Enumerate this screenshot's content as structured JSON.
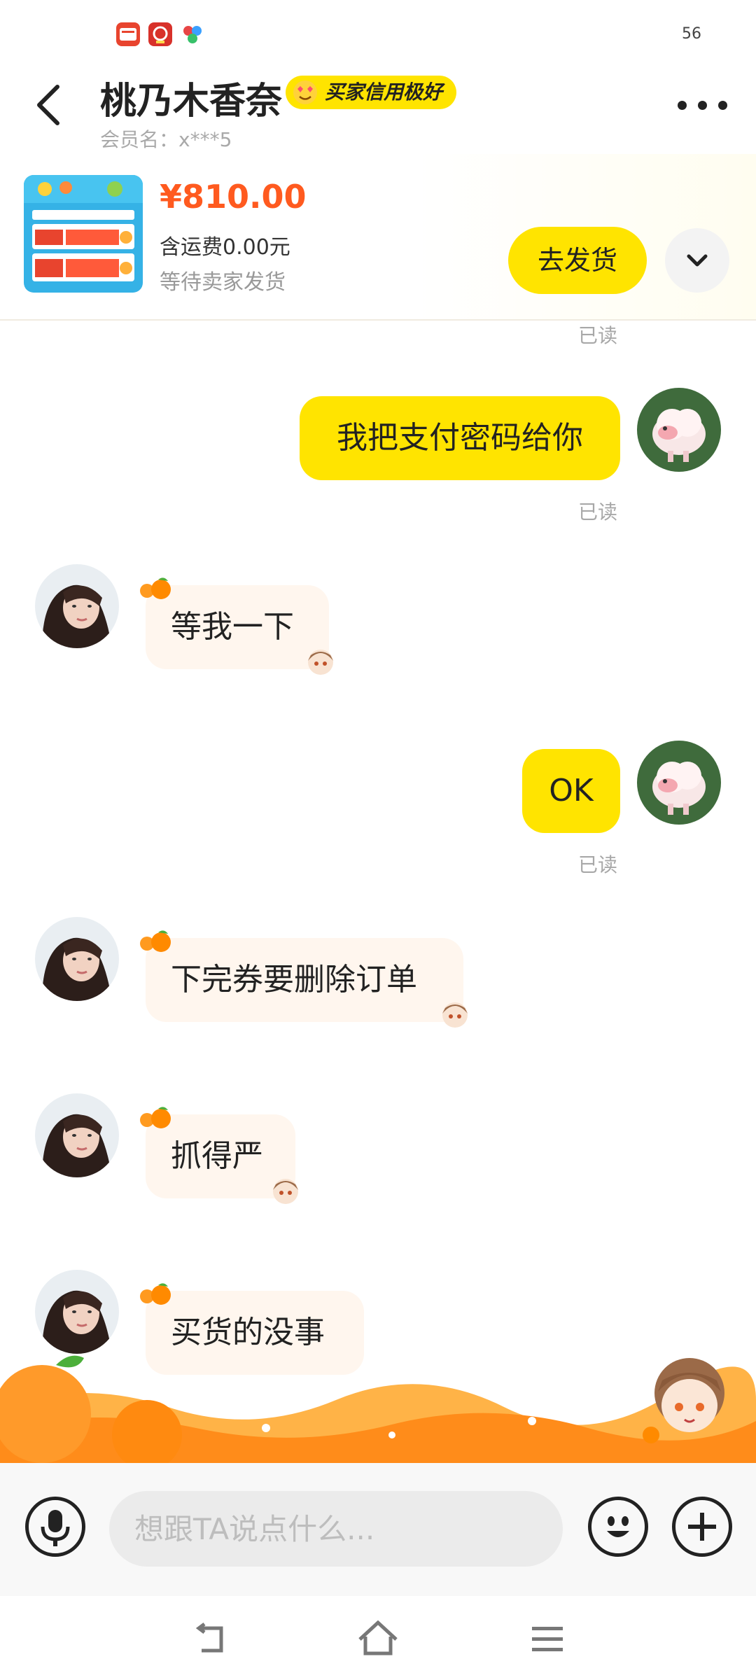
{
  "status_bar": {
    "value": "56",
    "apps": [
      "app-icon-1",
      "app-icon-2",
      "app-icon-3"
    ]
  },
  "header": {
    "contact_name": "桃乃木香奈",
    "credit_badge": "买家信用极好",
    "member_label": "会员名：x***5"
  },
  "order": {
    "price": "¥810.00",
    "shipping": "含运费0.00元",
    "status": "等待卖家发货",
    "ship_button": "去发货"
  },
  "chat": {
    "top_read_status": "已读",
    "messages": [
      {
        "side": "self",
        "text": "我把支付密码给你",
        "read": "已读"
      },
      {
        "side": "other",
        "text": "等我一下"
      },
      {
        "side": "self",
        "text": "OK",
        "read": "已读"
      },
      {
        "side": "other",
        "text": "下完券要删除订单"
      },
      {
        "side": "other",
        "text": "抓得严"
      },
      {
        "side": "other",
        "text": "买货的没事"
      }
    ]
  },
  "input": {
    "placeholder": "想跟TA说点什么..."
  },
  "colors": {
    "accent_yellow": "#ffe400",
    "price_orange": "#ff5a1f",
    "other_bubble": "#fff6ee",
    "read_gray": "#a8a8a8"
  }
}
